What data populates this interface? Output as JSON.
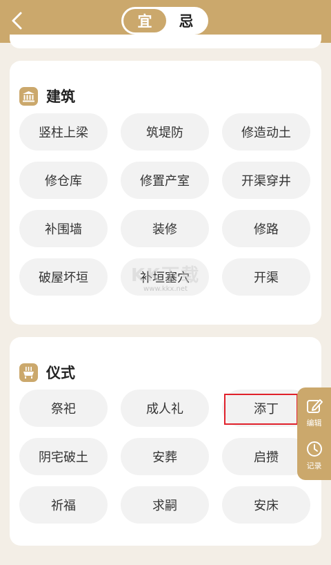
{
  "header": {
    "tabs": [
      {
        "label": "宜",
        "active": true
      },
      {
        "label": "忌",
        "active": false
      }
    ]
  },
  "sections": [
    {
      "title": "建筑",
      "icon": "building-icon",
      "items": [
        "竖柱上梁",
        "筑堤防",
        "修造动土",
        "修仓库",
        "修置产室",
        "开渠穿井",
        "补围墙",
        "装修",
        "修路",
        "破屋坏垣",
        "补垣塞穴",
        "开渠"
      ]
    },
    {
      "title": "仪式",
      "icon": "incense-burner-icon",
      "items": [
        "祭祀",
        "成人礼",
        "添丁",
        "阴宅破土",
        "安葬",
        "启攒",
        "祈福",
        "求嗣",
        "安床"
      ]
    }
  ],
  "floating_panel": {
    "edit_label": "编辑",
    "record_label": "记录"
  },
  "watermark": {
    "brand": "KK下载",
    "url": "www.kkx.net"
  },
  "colors": {
    "accent": "#cba86c",
    "pill_bg": "#f2f2f2",
    "highlight": "#e0202a"
  }
}
